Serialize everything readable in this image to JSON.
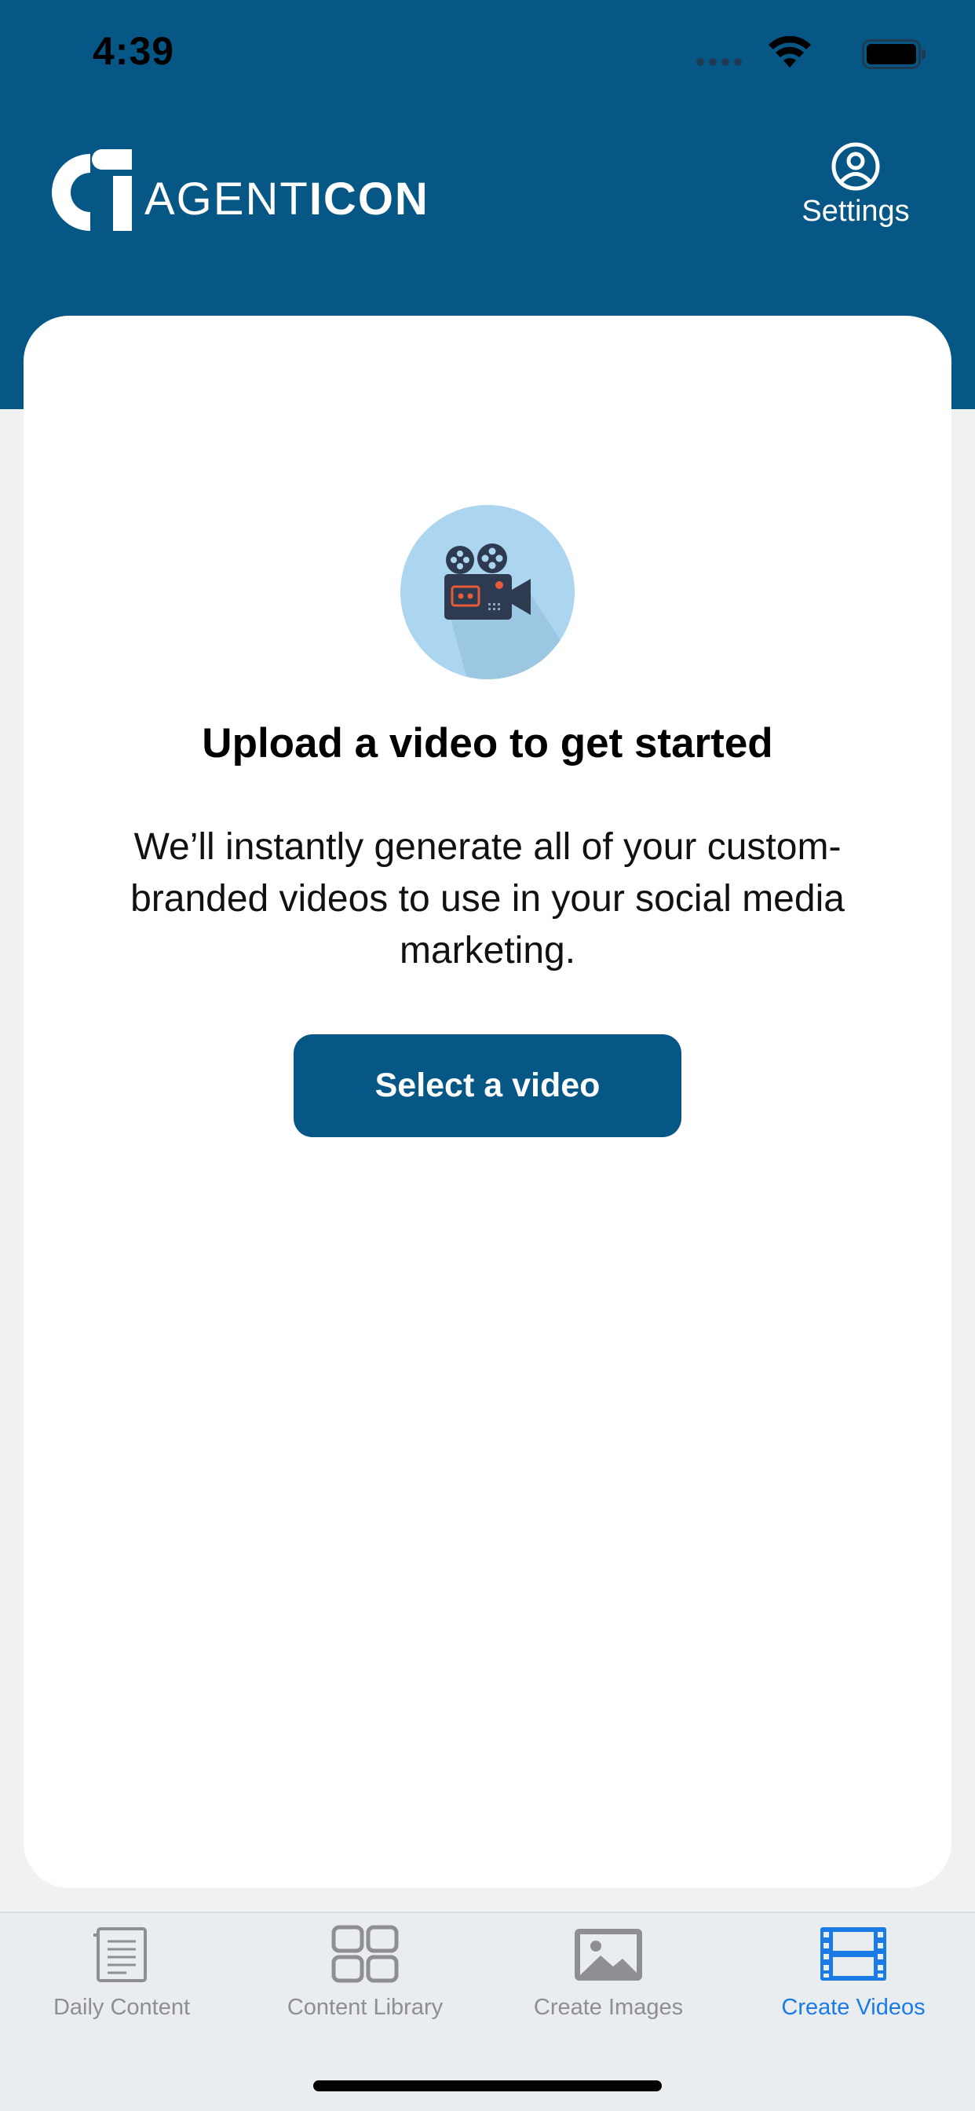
{
  "status_bar": {
    "time": "4:39"
  },
  "header": {
    "logo": {
      "mark": "ai",
      "text_light": "AGENT",
      "text_bold": "ICON"
    },
    "settings": {
      "label": "Settings",
      "icon": "user-circle-icon"
    },
    "background_color": "#065785"
  },
  "main": {
    "icon": "film-camera-icon",
    "title": "Upload a video to get started",
    "description": "We’ll instantly generate all of your custom-branded videos to use in your social media marketing.",
    "button_label": "Select a video",
    "button_color": "#065785"
  },
  "tabs": [
    {
      "label": "Daily Content",
      "icon": "document-icon",
      "active": false
    },
    {
      "label": "Content Library",
      "icon": "grid-icon",
      "active": false
    },
    {
      "label": "Create Images",
      "icon": "image-icon",
      "active": false
    },
    {
      "label": "Create Videos",
      "icon": "film-strip-icon",
      "active": true
    }
  ],
  "colors": {
    "active_tab": "#1b7be6",
    "inactive_tab": "#8e8e93"
  }
}
